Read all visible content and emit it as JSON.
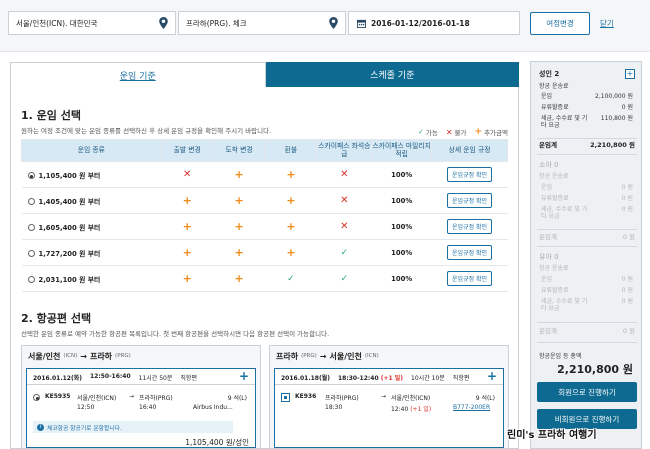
{
  "search": {
    "origin": "서울/인천(ICN). 대한민국",
    "destination": "프라하(PRG). 체크",
    "dates": "2016-01-12/2016-01-18",
    "change_button": "여정변경",
    "close_link": "닫기"
  },
  "tabs": [
    "운임 기준",
    "스케줄 기준"
  ],
  "fare_section": {
    "title": "1. 운임 선택",
    "description": "원하는 여정 조건에 맞는 운임 종류를 선택하신 후 상세 운임 규정을 확인해 주시기 바랍니다.",
    "legend": [
      {
        "symbol": "✓",
        "label": "가능"
      },
      {
        "symbol": "✕",
        "label": "불가"
      },
      {
        "symbol": "+",
        "label": "추가금액"
      }
    ],
    "headers": [
      "운임 종류",
      "출발 변경",
      "도착 변경",
      "환불",
      "스카이패스 좌석승급",
      "스카이패스 마일리지 적립",
      "상세 운임 규정"
    ],
    "rows": [
      {
        "fare": "1,105,400 원 부터",
        "selected": true,
        "departure_change": "x",
        "arrival_change": "plus",
        "refund": "plus",
        "upgrade": "x",
        "mileage": "100%",
        "rule": "운임규정 확인"
      },
      {
        "fare": "1,405,400 원 부터",
        "selected": false,
        "departure_change": "plus",
        "arrival_change": "plus",
        "refund": "plus",
        "upgrade": "x",
        "mileage": "100%",
        "rule": "운임규정 확인"
      },
      {
        "fare": "1,605,400 원 부터",
        "selected": false,
        "departure_change": "plus",
        "arrival_change": "plus",
        "refund": "plus",
        "upgrade": "x",
        "mileage": "100%",
        "rule": "운임규정 확인"
      },
      {
        "fare": "1,727,200 원 부터",
        "selected": false,
        "departure_change": "plus",
        "arrival_change": "plus",
        "refund": "plus",
        "upgrade": "check",
        "mileage": "100%",
        "rule": "운임규정 확인"
      },
      {
        "fare": "2,031,100 원 부터",
        "selected": false,
        "departure_change": "plus",
        "arrival_change": "plus",
        "refund": "check",
        "upgrade": "check",
        "mileage": "100%",
        "rule": "운임규정 확인"
      }
    ]
  },
  "flight_section": {
    "title": "2. 항공편 선택",
    "description": "선택한 운임 종류로 예약 가능한 항공편 목록입니다. 첫 번째 항공편을 선택하시면 다음 항공편 선택이 가능합니다.",
    "outbound": {
      "from": "서울/인천",
      "from_code": "(ICN)",
      "to": "프라하",
      "to_code": "(PRG)",
      "date": "2016.01.12(화)",
      "time": "12:50-16:40",
      "duration": "11시간 50분",
      "type": "직항편",
      "flight_no": "KE5935",
      "dep_place": "서울/인천(ICN)",
      "dep_time": "12:50",
      "arr_place": "프라하(PRG)",
      "arr_time": "16:40",
      "seats": "9 석(L)",
      "operator": "Airbus Indu...",
      "note": "체코항공 항공기로 운항합니다.",
      "price": "1,105,400 원/성인"
    },
    "inbound": {
      "from": "프라하",
      "from_code": "(PRG)",
      "to": "서울/인천",
      "to_code": "(ICN)",
      "date": "2016.01.18(월)",
      "time": "18:30-12:40",
      "day_plus": "(+1 일)",
      "duration": "10시간 10분",
      "type": "직항편",
      "flight_no": "KE936",
      "dep_place": "프라하(PRG)",
      "dep_time": "18:30",
      "arr_place": "서울/인천(ICN)",
      "arr_time": "12:40",
      "seats": "9 석(L)",
      "aircraft": "B777-200ER"
    }
  },
  "summary": {
    "adult": {
      "title": "성인 2",
      "fare_label": "항공 운송료",
      "rows": [
        {
          "label": "운임",
          "value": "2,100,000 원"
        },
        {
          "label": "유류할증료",
          "value": "0 원"
        },
        {
          "label": "세금, 수수료 및 기타 요금",
          "value": "110,800 원"
        }
      ],
      "total_label": "운임계",
      "total_value": "2,210,800 원"
    },
    "child": {
      "title": "소아 0",
      "fare_label": "항공 운송료",
      "rows": [
        {
          "label": "운임",
          "value": "0 원"
        },
        {
          "label": "유류할증료",
          "value": "0 원"
        },
        {
          "label": "세금, 수수료 및 기타 요금",
          "value": "0 원"
        }
      ],
      "total_label": "운임계",
      "total_value": "0 원"
    },
    "infant": {
      "title": "유아 0",
      "fare_label": "항공 운송료",
      "rows": [
        {
          "label": "운임",
          "value": "0 원"
        },
        {
          "label": "유류할증료",
          "value": "0 원"
        },
        {
          "label": "세금, 수수료 및 기타 요금",
          "value": "0 원"
        }
      ],
      "total_label": "운임계",
      "total_value": "0 원"
    },
    "grand_total_label": "항공운임 등 총액",
    "grand_total": "2,210,800 원",
    "member_button": "회원으로 진행하기",
    "nonmember_button": "비회원으로 진행하기"
  },
  "watermark": "린미's 프라하 여행기"
}
